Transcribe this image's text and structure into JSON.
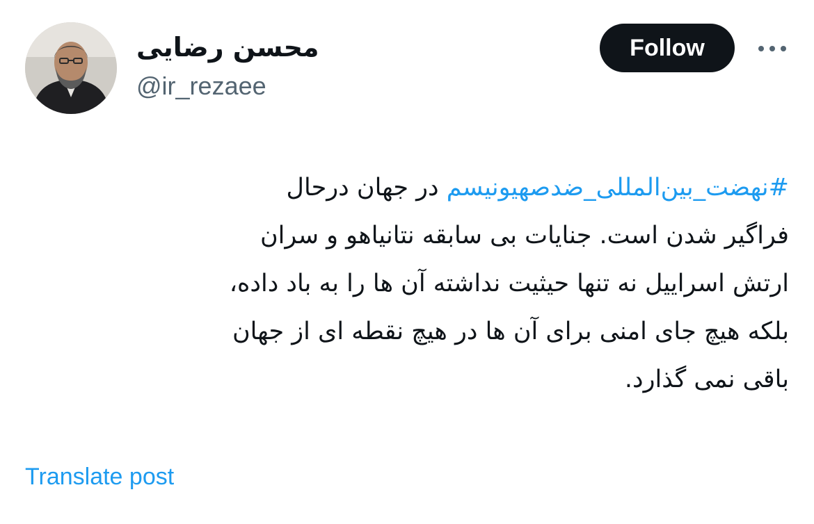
{
  "author": {
    "display_name": "محسن رضایی",
    "handle": "@ir_rezaee",
    "avatar_icon": "profile-photo"
  },
  "actions": {
    "follow_label": "Follow",
    "more_icon": "ellipsis-icon"
  },
  "tweet": {
    "hashtag": "#نهضت_بین‌المللی_ضدصهیونیسم",
    "line1_rest": " در جهان درحال",
    "line2": "فراگیر شدن است. جنایات بی سابقه نتانیاهو و سران",
    "line3": "ارتش اسراییل نه تنها حیثیت نداشته آن ها را به باد داده،",
    "line4": "بلکه هیچ جای امنی برای آن ها در هیچ نقطه ای از جهان",
    "line5": "باقی نمی گذارد."
  },
  "footer": {
    "translate_label": "Translate post"
  },
  "colors": {
    "link": "#1d9bf0",
    "text": "#0f1419",
    "secondary": "#536471",
    "button_bg": "#0f1419"
  }
}
